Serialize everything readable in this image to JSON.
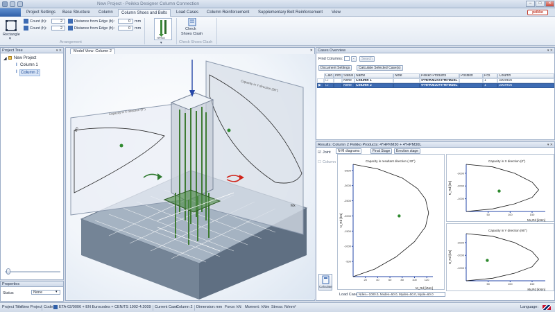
{
  "window": {
    "title": "New Project - Peikko Designer Column Connection",
    "minimize": "–",
    "maximize": "□",
    "close": "✕",
    "logo_text": "peikko"
  },
  "tabs": [
    "Project Settings",
    "Base Structure",
    "Column",
    "Column Shoes and Bolts",
    "Load Cases",
    "Column Reinforcement",
    "Supplementary Bolt Reinforcement",
    "View"
  ],
  "active_tab": "Column Shoes and Bolts",
  "ribbon": {
    "rectangle_label": "Rectangle",
    "count_b_label": "Count (b):",
    "count_b_value": "2",
    "count_h_label": "Count (h):",
    "count_h_value": "2",
    "dist_b_label": "Distance from Edge (b):",
    "dist_b_value": "0",
    "dist_b_unit": "mm",
    "dist_h_label": "Distance from Edge (h):",
    "dist_h_value": "0",
    "dist_h_unit": "mm",
    "arrangement_group": "Arrangement",
    "product_label": "HPKM",
    "check_label_1": "Check",
    "check_label_2": "Shoes Clash",
    "check_group": "Check Shoes Clash"
  },
  "project_tree": {
    "title": "Project Tree",
    "root": "New Project",
    "items": [
      "Column 1",
      "Column 2"
    ]
  },
  "properties": {
    "title": "Properties",
    "status_label": "Status",
    "status_value": "None"
  },
  "model_view": {
    "tab": "Model View: Column 2",
    "caption_left": "Capacity in X direction (0°)",
    "caption_right": "Capacity in Y direction (90°)",
    "axis_left": "My",
    "axis_right": "Mx"
  },
  "cases": {
    "title": "Cases Overview",
    "find_label": "Find Columns:",
    "search_label": "Search",
    "doc_settings": "Document Settings",
    "calc_selected": "Calculate Selected Case(s)",
    "columns": [
      "Calc.",
      "Info",
      "Status",
      "Name",
      "Note",
      "Peikko Products",
      "Position",
      "Pcs",
      "Column"
    ],
    "rows": [
      {
        "status": "None",
        "name": "Column 1",
        "product": "4*HPKM24+4*HPM24L",
        "pcs": "1",
        "column": "300x400"
      },
      {
        "status": "None",
        "name": "Column 2",
        "product": "4*HPKM30+4*HPM30L",
        "pcs": "1",
        "column": "300x400"
      }
    ]
  },
  "results": {
    "title": "Results: Column 2   Peikko Products: 4*HPKM30 + 4*HPM30L",
    "tabs": [
      "N-M diagrams",
      "Final Stage",
      "Erection stage"
    ],
    "joint_label": "Joint",
    "column_label": "Column",
    "calculate_label": "Calculate",
    "load_case_label": "Load Case",
    "load_case_value": "Ndes=-1000.0, Mxdes=50.0, Mydes=50.0, Myde=60.0"
  },
  "chart_data": [
    {
      "type": "line",
      "title": "Capacity in resultant direction (-32°)",
      "xlabel": "M_Rd [kNm]",
      "ylabel": "N_Rd [kN]",
      "x_ticks": [
        20,
        40,
        60,
        80,
        100,
        120
      ],
      "y_ticks": [
        -500,
        -1000,
        -1500,
        -2000,
        -2500,
        -3000,
        -3500
      ],
      "series": [
        {
          "x": [
            0,
            40,
            80,
            105,
            118,
            123,
            118,
            100,
            70,
            35,
            0
          ],
          "y": [
            -3700,
            -3550,
            -3250,
            -2900,
            -2550,
            -2100,
            -1650,
            -1150,
            -650,
            -250,
            0
          ]
        }
      ],
      "point": {
        "x": 75,
        "y": -2000
      }
    },
    {
      "type": "line",
      "title": "Capacity in X direction (0°)",
      "xlabel": "Mx,Rd [kNm]",
      "ylabel": "N_Rd [kN]",
      "x_ticks": [
        50,
        100,
        150
      ],
      "y_ticks": [
        -1000,
        -2000,
        -3000
      ],
      "series": [
        {
          "x": [
            0,
            60,
            110,
            150,
            165,
            150,
            110,
            60,
            0
          ],
          "y": [
            -3700,
            -3500,
            -3000,
            -2300,
            -1700,
            -1100,
            -600,
            -200,
            0
          ]
        }
      ],
      "point": {
        "x": 75,
        "y": -1600
      }
    },
    {
      "type": "line",
      "title": "Capacity in Y direction (90°)",
      "xlabel": "My,Rd [kNm]",
      "ylabel": "N_Rd [kN]",
      "x_ticks": [
        50,
        100,
        150
      ],
      "y_ticks": [
        -1000,
        -2000,
        -3000
      ],
      "series": [
        {
          "x": [
            0,
            60,
            110,
            150,
            165,
            150,
            110,
            60,
            0
          ],
          "y": [
            -3700,
            -3500,
            -3000,
            -2300,
            -1700,
            -1100,
            -600,
            -200,
            0
          ]
        }
      ],
      "point": {
        "x": 48,
        "y": -1600
      }
    }
  ],
  "statusbar": {
    "project_label": "Project Title:",
    "project_value": "New Project",
    "code_label": "Code:",
    "code_value": "ETA-02/0006 + EN Eurocodes + CEN/TS 1992-4:2009",
    "current_case_label": "Current Case:",
    "current_case_value": "Column 2",
    "dimension_label": "Dimension:",
    "dimension_value": "mm",
    "force_label": "Force:",
    "force_value": "kN",
    "moment_label": "Moment:",
    "moment_value": "kNm",
    "stress_label": "Stress:",
    "stress_value": "N/mm²",
    "language_label": "Language:"
  }
}
